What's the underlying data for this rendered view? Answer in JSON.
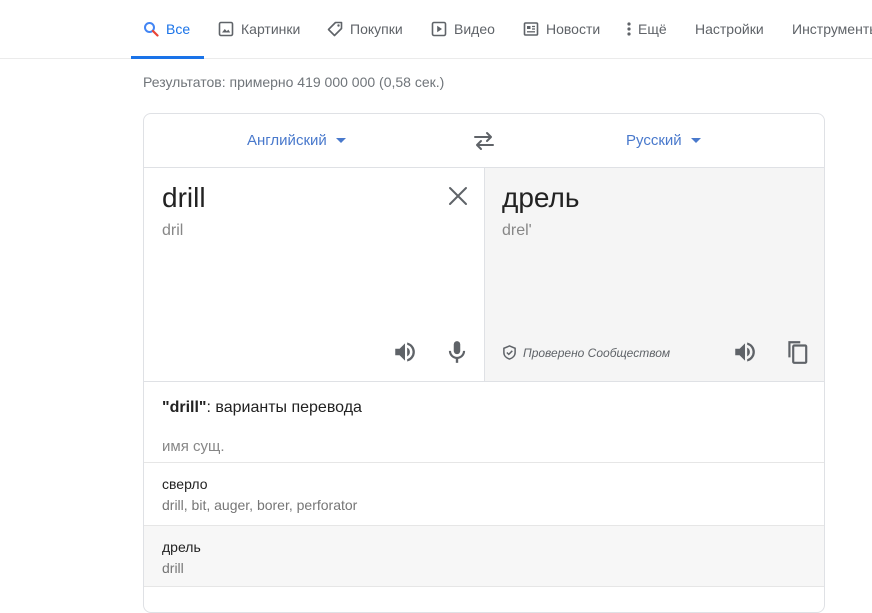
{
  "tabs": [
    {
      "label": "Все",
      "icon": "search-icon"
    },
    {
      "label": "Картинки",
      "icon": "image-icon"
    },
    {
      "label": "Покупки",
      "icon": "tag-icon"
    },
    {
      "label": "Видео",
      "icon": "play-icon"
    },
    {
      "label": "Новости",
      "icon": "news-icon"
    },
    {
      "label": "Ещё",
      "icon": "more-vert-icon"
    },
    {
      "label": "Настройки"
    },
    {
      "label": "Инструменты"
    }
  ],
  "stats": "Результатов: примерно 419 000 000 (0,58 сек.)",
  "translate": {
    "source_lang": "Английский",
    "target_lang": "Русский",
    "source_text": "drill",
    "source_translit": "dril",
    "target_text": "дрель",
    "target_translit": "drel'",
    "verified_label": "Проверено Сообществом"
  },
  "alternatives": {
    "title_word": "\"drill\"",
    "title_rest": ": варианты перевода",
    "part_of_speech": "имя сущ.",
    "items": [
      {
        "word": "сверло",
        "synonyms": "drill, bit, auger, borer, perforator"
      },
      {
        "word": "дрель",
        "synonyms": "drill"
      }
    ]
  },
  "colors": {
    "accent": "#1a73e8",
    "lang_link": "#4979cc",
    "target_panel_bg": "#f5f5f5"
  }
}
